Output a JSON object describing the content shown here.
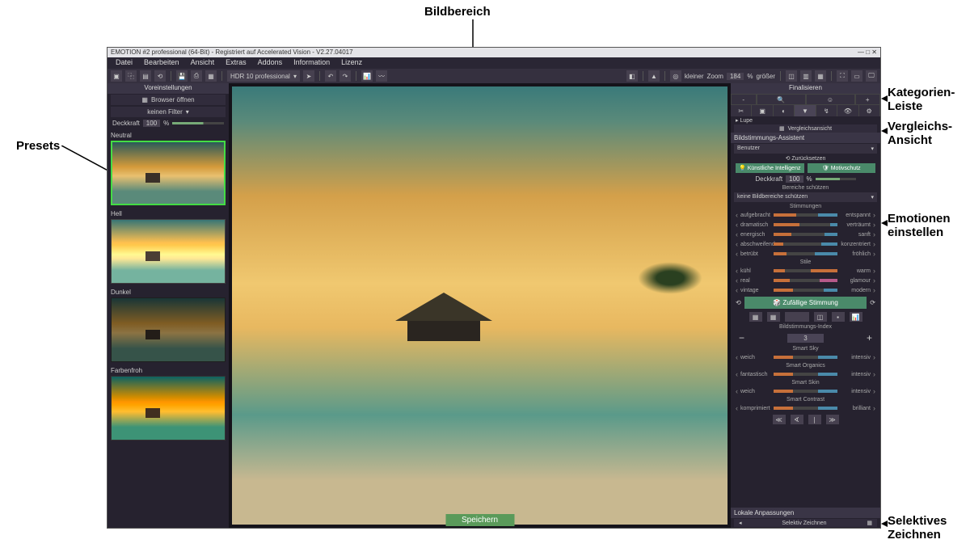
{
  "annotations": {
    "bildbereich": "Bildbereich",
    "kategorien": "Kategorien-\nLeiste",
    "vergleich": "Vergleichs-\nAnsicht",
    "emotionen": "Emotionen\neinstellen",
    "selektiv": "Selektives\nZeichnen",
    "presets": "Presets"
  },
  "titlebar": "EMOTION #2 professional (64-Bit) - Registriert auf Accelerated Vision - V2.27.04017",
  "window_controls": {
    "min": "—",
    "max": "□",
    "close": "✕"
  },
  "menu": [
    "Datei",
    "Bearbeiten",
    "Ansicht",
    "Extras",
    "Addons",
    "Information",
    "Lizenz"
  ],
  "toolbar": {
    "dropdown1": "HDR 10 professional",
    "zoom_label": "Zoom",
    "zoom_value": "184",
    "zoom_pct": "%",
    "smaller": "kleiner",
    "larger": "größer"
  },
  "left": {
    "header": "Voreinstellungen",
    "browser": "Browser öffnen",
    "filter": "keinen Filter",
    "opacity_label": "Deckkraft",
    "opacity_value": "100",
    "opacity_pct": "%",
    "presets": [
      {
        "name": "Neutral",
        "selected": true
      },
      {
        "name": "Hell",
        "selected": false
      },
      {
        "name": "Dunkel",
        "selected": false
      },
      {
        "name": "Farbenfroh",
        "selected": false
      }
    ]
  },
  "right": {
    "finalize": "Finalisieren",
    "lupe": "▸ Lupe",
    "compare": "Vergleichsansicht",
    "assistant_title": "Bildstimmungs-Assistent",
    "user_dropdown": "Benutzer",
    "reset": "⟲ Zurücksetzen",
    "ai_btn": "Künstliche Intelligenz",
    "protect_btn": "Motivschutz",
    "opacity_label": "Deckkraft",
    "opacity_value": "100",
    "opacity_pct": "%",
    "protect_section": "Bereiche schützen",
    "protect_dropdown": "keine Bildbereiche schützen",
    "moods_title": "Stimmungen",
    "moods": [
      {
        "l": "aufgebracht",
        "r": "entspannt",
        "lf": 35,
        "rf": 30
      },
      {
        "l": "dramatisch",
        "r": "verträumt",
        "lf": 40,
        "rf": 12
      },
      {
        "l": "energisch",
        "r": "sanft",
        "lf": 28,
        "rf": 20
      },
      {
        "l": "abschweifend",
        "r": "konzentriert",
        "lf": 15,
        "rf": 25
      },
      {
        "l": "betrübt",
        "r": "fröhlich",
        "lf": 20,
        "rf": 35
      }
    ],
    "styles_title": "Stile",
    "styles": [
      {
        "l": "kühl",
        "r": "warm",
        "lf": 18,
        "rf": 42,
        "cr": "#c7703a"
      },
      {
        "l": "real",
        "r": "glamour",
        "lf": 25,
        "rf": 28,
        "cr": "#b75a8a"
      },
      {
        "l": "vintage",
        "r": "modern",
        "lf": 30,
        "rf": 22,
        "cr": "#4a8aaa"
      }
    ],
    "random": "Zufällige Stimmung",
    "index_title": "Bildstimmungs-Index",
    "index_value": "3",
    "smart": [
      {
        "title": "Smart Sky",
        "l": "weich",
        "r": "intensiv"
      },
      {
        "title": "Smart Organics",
        "l": "fantastisch",
        "r": "intensiv"
      },
      {
        "title": "Smart Skin",
        "l": "weich",
        "r": "intensiv"
      },
      {
        "title": "Smart Contrast",
        "l": "komprimiert",
        "r": "brilliant"
      }
    ],
    "local_title": "Lokale Anpassungen",
    "selective": "Selektiv Zeichnen"
  },
  "save": "Speichern"
}
